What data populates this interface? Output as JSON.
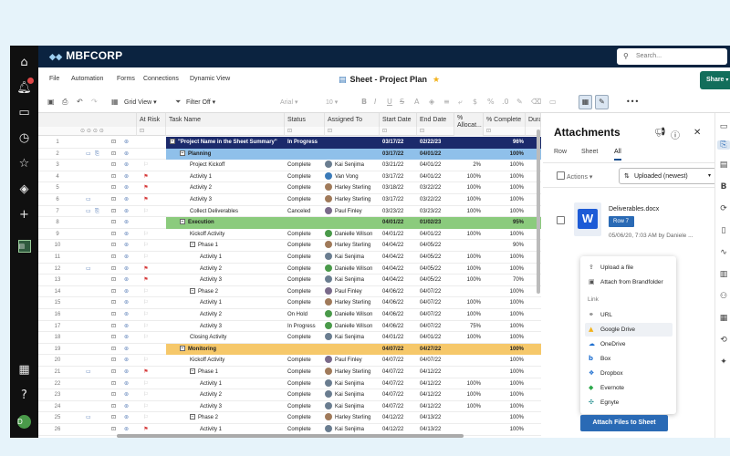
{
  "brand": "MBFCORP",
  "search": {
    "placeholder": "Search..."
  },
  "menu": [
    "File",
    "Automation",
    "Forms",
    "Connections",
    "Dynamic View"
  ],
  "sheet_title": "Sheet - Project Plan",
  "share_label": "Share",
  "toolbar": {
    "grid_view": "Grid View",
    "filter": "Filter Off",
    "font": "Arial",
    "size": "10"
  },
  "columns": {
    "at_risk": "At Risk",
    "task_name": "Task Name",
    "status": "Status",
    "assigned": "Assigned To",
    "start": "Start Date",
    "end": "End Date",
    "alloc": "% Allocat...",
    "pct": "% Complete",
    "dur": "Dura"
  },
  "rows": [
    {
      "n": "1",
      "task": "\"Project Name in the Sheet Summary\"",
      "indent": 0,
      "toggle": "−",
      "status": "In Progress",
      "assigned": "",
      "start": "03/17/22",
      "end": "02/22/23",
      "alloc": "",
      "pct": "96%",
      "kind": "project",
      "flag": "",
      "chat": false,
      "att": false
    },
    {
      "n": "2",
      "task": "Planning",
      "indent": 1,
      "toggle": "−",
      "status": "",
      "assigned": "",
      "start": "03/17/22",
      "end": "04/01/22",
      "alloc": "",
      "pct": "100%",
      "kind": "planning",
      "flag": "",
      "chat": true,
      "att": true
    },
    {
      "n": "3",
      "task": "Project Kickoff",
      "indent": 2,
      "toggle": "",
      "status": "Complete",
      "assigned": "Kai Senjima",
      "start": "03/21/22",
      "end": "04/01/22",
      "alloc": "2%",
      "pct": "100%",
      "kind": "",
      "flag": "outline",
      "chat": false,
      "att": false
    },
    {
      "n": "4",
      "task": "Activity 1",
      "indent": 2,
      "toggle": "",
      "status": "Complete",
      "assigned": "Van Vong",
      "start": "03/17/22",
      "end": "04/01/22",
      "alloc": "100%",
      "pct": "100%",
      "kind": "",
      "flag": "red",
      "chat": false,
      "att": false
    },
    {
      "n": "5",
      "task": "Activity 2",
      "indent": 2,
      "toggle": "",
      "status": "Complete",
      "assigned": "Harley Sterling",
      "start": "03/18/22",
      "end": "03/22/22",
      "alloc": "100%",
      "pct": "100%",
      "kind": "",
      "flag": "red",
      "chat": false,
      "att": false
    },
    {
      "n": "6",
      "task": "Activity 3",
      "indent": 2,
      "toggle": "",
      "status": "Complete",
      "assigned": "Harley Sterling",
      "start": "03/17/22",
      "end": "03/22/22",
      "alloc": "100%",
      "pct": "100%",
      "kind": "",
      "flag": "red",
      "chat": true,
      "att": false
    },
    {
      "n": "7",
      "task": "Collect Deliverables",
      "indent": 2,
      "toggle": "",
      "status": "Canceled",
      "assigned": "Paul Finley",
      "start": "03/23/22",
      "end": "03/23/22",
      "alloc": "100%",
      "pct": "100%",
      "kind": "",
      "flag": "outline",
      "chat": true,
      "att": true
    },
    {
      "n": "8",
      "task": "Execution",
      "indent": 1,
      "toggle": "−",
      "status": "",
      "assigned": "",
      "start": "04/01/22",
      "end": "01/02/23",
      "alloc": "",
      "pct": "95%",
      "kind": "execution",
      "flag": "",
      "chat": false,
      "att": false
    },
    {
      "n": "9",
      "task": "Kickoff Activity",
      "indent": 2,
      "toggle": "",
      "status": "Complete",
      "assigned": "Danielle Wilson",
      "start": "04/01/22",
      "end": "04/01/22",
      "alloc": "100%",
      "pct": "100%",
      "kind": "",
      "flag": "outline",
      "chat": false,
      "att": false
    },
    {
      "n": "10",
      "task": "Phase 1",
      "indent": 2,
      "toggle": "−",
      "status": "Complete",
      "assigned": "Harley Sterling",
      "start": "04/04/22",
      "end": "04/05/22",
      "alloc": "",
      "pct": "90%",
      "kind": "",
      "flag": "outline",
      "chat": false,
      "att": false
    },
    {
      "n": "11",
      "task": "Activity 1",
      "indent": 3,
      "toggle": "",
      "status": "Complete",
      "assigned": "Kai Senjima",
      "start": "04/04/22",
      "end": "04/05/22",
      "alloc": "100%",
      "pct": "100%",
      "kind": "",
      "flag": "outline",
      "chat": false,
      "att": false
    },
    {
      "n": "12",
      "task": "Activity 2",
      "indent": 3,
      "toggle": "",
      "status": "Complete",
      "assigned": "Danielle Wilson",
      "start": "04/04/22",
      "end": "04/05/22",
      "alloc": "100%",
      "pct": "100%",
      "kind": "",
      "flag": "red",
      "chat": true,
      "att": false
    },
    {
      "n": "13",
      "task": "Activity 3",
      "indent": 3,
      "toggle": "",
      "status": "Complete",
      "assigned": "Kai Senjima",
      "start": "04/04/22",
      "end": "04/05/22",
      "alloc": "100%",
      "pct": "70%",
      "kind": "",
      "flag": "red",
      "chat": false,
      "att": false
    },
    {
      "n": "14",
      "task": "Phase 2",
      "indent": 2,
      "toggle": "−",
      "status": "Complete",
      "assigned": "Paul Finley",
      "start": "04/06/22",
      "end": "04/07/22",
      "alloc": "",
      "pct": "100%",
      "kind": "",
      "flag": "outline",
      "chat": false,
      "att": false
    },
    {
      "n": "15",
      "task": "Activity 1",
      "indent": 3,
      "toggle": "",
      "status": "Complete",
      "assigned": "Harley Sterling",
      "start": "04/06/22",
      "end": "04/07/22",
      "alloc": "100%",
      "pct": "100%",
      "kind": "",
      "flag": "outline",
      "chat": false,
      "att": false
    },
    {
      "n": "16",
      "task": "Activity 2",
      "indent": 3,
      "toggle": "",
      "status": "On Hold",
      "assigned": "Danielle Wilson",
      "start": "04/06/22",
      "end": "04/07/22",
      "alloc": "100%",
      "pct": "100%",
      "kind": "",
      "flag": "outline",
      "chat": false,
      "att": false
    },
    {
      "n": "17",
      "task": "Activity 3",
      "indent": 3,
      "toggle": "",
      "status": "In Progress",
      "assigned": "Danielle Wilson",
      "start": "04/06/22",
      "end": "04/07/22",
      "alloc": "75%",
      "pct": "100%",
      "kind": "",
      "flag": "outline",
      "chat": false,
      "att": false
    },
    {
      "n": "18",
      "task": "Closing Activity",
      "indent": 2,
      "toggle": "",
      "status": "Complete",
      "assigned": "Kai Senjima",
      "start": "04/01/22",
      "end": "04/01/22",
      "alloc": "100%",
      "pct": "100%",
      "kind": "",
      "flag": "outline",
      "chat": false,
      "att": false
    },
    {
      "n": "19",
      "task": "Monitoring",
      "indent": 1,
      "toggle": "−",
      "status": "",
      "assigned": "",
      "start": "04/07/22",
      "end": "04/27/22",
      "alloc": "",
      "pct": "100%",
      "kind": "monitoring",
      "flag": "",
      "chat": false,
      "att": false
    },
    {
      "n": "20",
      "task": "Kickoff Activity",
      "indent": 2,
      "toggle": "",
      "status": "Complete",
      "assigned": "Paul Finley",
      "start": "04/07/22",
      "end": "04/07/22",
      "alloc": "",
      "pct": "100%",
      "kind": "",
      "flag": "outline",
      "chat": false,
      "att": false
    },
    {
      "n": "21",
      "task": "Phase 1",
      "indent": 2,
      "toggle": "−",
      "status": "Complete",
      "assigned": "Harley Sterling",
      "start": "04/07/22",
      "end": "04/12/22",
      "alloc": "",
      "pct": "100%",
      "kind": "",
      "flag": "red",
      "chat": true,
      "att": false
    },
    {
      "n": "22",
      "task": "Activity 1",
      "indent": 3,
      "toggle": "",
      "status": "Complete",
      "assigned": "Kai Senjima",
      "start": "04/07/22",
      "end": "04/12/22",
      "alloc": "100%",
      "pct": "100%",
      "kind": "",
      "flag": "outline",
      "chat": false,
      "att": false
    },
    {
      "n": "23",
      "task": "Activity 2",
      "indent": 3,
      "toggle": "",
      "status": "Complete",
      "assigned": "Kai Senjima",
      "start": "04/07/22",
      "end": "04/12/22",
      "alloc": "100%",
      "pct": "100%",
      "kind": "",
      "flag": "outline",
      "chat": false,
      "att": false
    },
    {
      "n": "24",
      "task": "Activity 3",
      "indent": 3,
      "toggle": "",
      "status": "Complete",
      "assigned": "Kai Senjima",
      "start": "04/07/22",
      "end": "04/12/22",
      "alloc": "100%",
      "pct": "100%",
      "kind": "",
      "flag": "outline",
      "chat": false,
      "att": false
    },
    {
      "n": "25",
      "task": "Phase 2",
      "indent": 2,
      "toggle": "−",
      "status": "Complete",
      "assigned": "Harley Sterling",
      "start": "04/12/22",
      "end": "04/13/22",
      "alloc": "",
      "pct": "100%",
      "kind": "",
      "flag": "outline",
      "chat": true,
      "att": false
    },
    {
      "n": "26",
      "task": "Activity 1",
      "indent": 3,
      "toggle": "",
      "status": "Complete",
      "assigned": "Kai Senjima",
      "start": "04/12/22",
      "end": "04/13/22",
      "alloc": "",
      "pct": "100%",
      "kind": "",
      "flag": "red",
      "chat": false,
      "att": false
    }
  ],
  "colors": {
    "project": "#1b2a6b",
    "planning": "#8fc0ea",
    "execution": "#8bcb7d",
    "monitoring": "#f6c86a",
    "brand_dark": "#0b2340",
    "accent_blue": "#2a6ab5",
    "share_green": "#126e5b"
  },
  "panel": {
    "title": "Attachments",
    "tabs": [
      "Row",
      "Sheet",
      "All"
    ],
    "actions": "Actions",
    "sort": "Uploaded (newest)",
    "file_name": "Deliverables.docx",
    "row_badge": "Row 7",
    "file_meta": "05/06/20, 7:03 AM by Daniele ...",
    "popup": {
      "upload": "Upload a file",
      "brandfolder": "Attach from Brandfolder",
      "link_label": "Link",
      "url": "URL",
      "google_drive": "Google Drive",
      "onedrive": "OneDrive",
      "box": "Box",
      "dropbox": "Dropbox",
      "evernote": "Evernote",
      "egnyte": "Egnyte"
    },
    "attach_button": "Attach Files to Sheet"
  },
  "user_initial": "D"
}
